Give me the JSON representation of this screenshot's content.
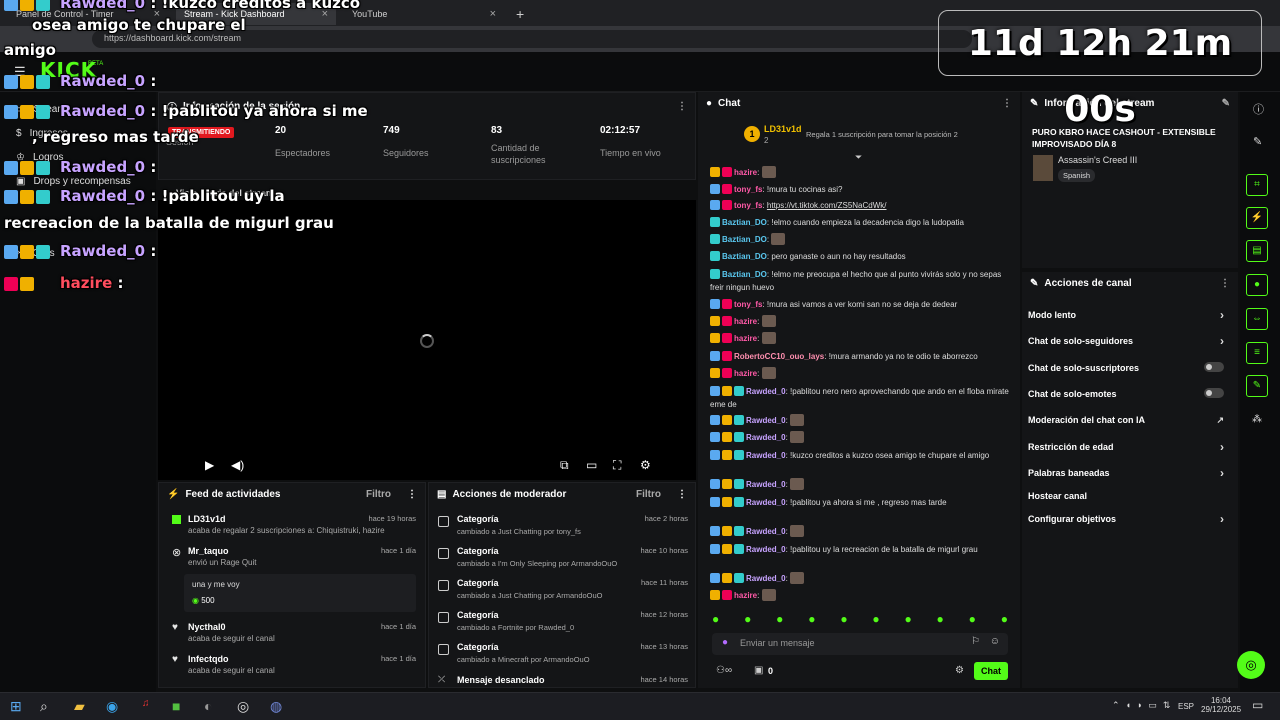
{
  "browser": {
    "tabs": [
      {
        "label": "Panel de Control - Timer"
      },
      {
        "label": "Stream - Kick Dashboard"
      },
      {
        "label": "YouTube"
      }
    ],
    "new_tab": "+",
    "url": "https://dashboard.kick.com/stream"
  },
  "logo": "KICK",
  "logo_badge": "BETA",
  "sidebar": {
    "items": [
      {
        "label": "Stream"
      },
      {
        "label": "Ingresos"
      },
      {
        "label": "Logros"
      },
      {
        "label": "Drops y recompensas"
      },
      {
        "label": "Clips"
      }
    ]
  },
  "session": {
    "title": "Información de la sesión",
    "live_badge": "TRANSMITIENDO",
    "stats": [
      {
        "value": "",
        "label": "Sesión"
      },
      {
        "value": "20",
        "label": "Espectadores"
      },
      {
        "value": "749",
        "label": "Seguidores"
      },
      {
        "value": "83",
        "label": "Cantidad de suscripciones"
      },
      {
        "value": "02:12:57",
        "label": "Tiempo en vivo"
      }
    ],
    "preview_title": "Vista previa del stream"
  },
  "feed": {
    "title": "Feed de actividades",
    "filter": "Filtro",
    "items": [
      {
        "user": "LD31v1d",
        "time": "hace 19 horas",
        "text": "acaba de regalar 2 suscripciones a: Chiquistruki, hazire"
      },
      {
        "user": "Mr_taquo",
        "time": "hace 1 día",
        "text": "envió un Rage Quit",
        "msg": "una y me voy",
        "amount": "500"
      },
      {
        "user": "Nycthal0",
        "time": "hace 1 día",
        "text": "acaba de seguir el canal"
      },
      {
        "user": "Infectqdo",
        "time": "hace 1 día",
        "text": "acaba de seguir el canal"
      }
    ]
  },
  "mod": {
    "title": "Acciones de moderador",
    "filter": "Filtro",
    "items": [
      {
        "title": "Categoría",
        "time": "hace 2 horas",
        "text": "cambiado a Just Chatting por tony_fs"
      },
      {
        "title": "Categoría",
        "time": "hace 10 horas",
        "text": "cambiado a I'm Only Sleeping por ArmandoOuO"
      },
      {
        "title": "Categoría",
        "time": "hace 11 horas",
        "text": "cambiado a Just Chatting por ArmandoOuO"
      },
      {
        "title": "Categoría",
        "time": "hace 12 horas",
        "text": "cambiado a Fortnite por Rawded_0"
      },
      {
        "title": "Categoría",
        "time": "hace 13 horas",
        "text": "cambiado a Minecraft por ArmandoOuO"
      },
      {
        "title": "Mensaje desanclado",
        "time": "hace 14 horas",
        "text": ""
      }
    ]
  },
  "chat": {
    "title": "Chat",
    "top_gifter": "LD31v1d",
    "top_gifter_count": "2",
    "gift_prompt": "Regala 1 suscripción para tomar la posición 2",
    "messages": [
      {
        "user": "hazire",
        "text": ""
      },
      {
        "user": "tony_fs",
        "text": "!mura  tu cocinas asi?"
      },
      {
        "user": "tony_fs",
        "text": "https://vt.tiktok.com/ZS5NaCdWk/"
      },
      {
        "user": "Baztian_DO",
        "text": "!elmo  cuando empieza la decadencia digo la ludopatia"
      },
      {
        "user": "Baztian_DO",
        "text": ""
      },
      {
        "user": "Baztian_DO",
        "text": "pero ganaste o aun no hay resultados"
      },
      {
        "user": "Baztian_DO",
        "text": "!elmo  me preocupa el hecho que al punto vivirás solo y no sepas freir ningun huevo"
      },
      {
        "user": "tony_fs",
        "text": "!mura asi vamos a ver komi san no se deja de dedear"
      },
      {
        "user": "hazire",
        "text": ""
      },
      {
        "user": "hazire",
        "text": ""
      },
      {
        "user": "RobertoCC10_ouo_lays",
        "text": "!mura armando ya no te odio te aborrezco"
      },
      {
        "user": "hazire",
        "text": ""
      },
      {
        "user": "Rawded_0",
        "text": "!pablitou nero nero aprovechando que ando en el floba mirate eme de"
      },
      {
        "user": "Rawded_0",
        "text": ""
      },
      {
        "user": "Rawded_0",
        "text": ""
      },
      {
        "user": "Rawded_0",
        "text": "!kuzco creditos a kuzco  osea  amigo te chupare el  amigo"
      },
      {
        "user": "Rawded_0",
        "text": ""
      },
      {
        "user": "Rawded_0",
        "text": "!pablitou ya ahora si me  , regreso mas tarde"
      },
      {
        "user": "Rawded_0",
        "text": ""
      },
      {
        "user": "Rawded_0",
        "text": "!pablitou uy   la recreacion de la batalla de migurl grau"
      },
      {
        "user": "Rawded_0",
        "text": ""
      },
      {
        "user": "hazire",
        "text": ""
      }
    ],
    "input_placeholder": "Enviar un mensaje",
    "points": "0",
    "send": "Chat"
  },
  "stream_info": {
    "title": "Información del stream",
    "stream_title": "PURO KBRO HACE CASHOUT - EXTENSIBLE IMPROVISADO DÍA 8",
    "game": "Assassin's Creed III",
    "language": "Spanish"
  },
  "channel_actions": {
    "title": "Acciones de canal",
    "items": [
      {
        "label": "Modo lento",
        "control": "chevron"
      },
      {
        "label": "Chat de solo-seguidores",
        "control": "chevron"
      },
      {
        "label": "Chat de solo-suscriptores",
        "control": "toggle"
      },
      {
        "label": "Chat de solo-emotes",
        "control": "toggle"
      },
      {
        "label": "Moderación del chat con IA",
        "control": "link"
      },
      {
        "label": "Restricción de edad",
        "control": "chevron"
      },
      {
        "label": "Palabras baneadas",
        "control": "chevron"
      },
      {
        "label": "Hostear canal",
        "control": "none"
      },
      {
        "label": "Configurar objetivos",
        "control": "chevron"
      }
    ]
  },
  "overlay": {
    "timer": "11d 12h 21m 00s",
    "lines": [
      {
        "name": "Rawded_0",
        "text": " : !kuzco creditos a kuzco"
      },
      {
        "name": "",
        "text": "osea   amigo te chupare el"
      },
      {
        "name": "",
        "text": "amigo"
      },
      {
        "name": "Rawded_0",
        "text": " :"
      },
      {
        "name": "Rawded_0",
        "text": " : !pablitou ya ahora si me"
      },
      {
        "name": "",
        "text": ", regreso mas tarde"
      },
      {
        "name": "Rawded_0",
        "text": " :"
      },
      {
        "name": "Rawded_0",
        "text": " : !pablitou uy      la"
      },
      {
        "name": "",
        "text": "recreacion de la batalla de migurl grau"
      },
      {
        "name": "Rawded_0",
        "text": " :"
      },
      {
        "name": "hazire",
        "text": " :"
      }
    ]
  },
  "taskbar": {
    "lang": "ESP",
    "time": "16:04",
    "date": "29/12/2025"
  }
}
